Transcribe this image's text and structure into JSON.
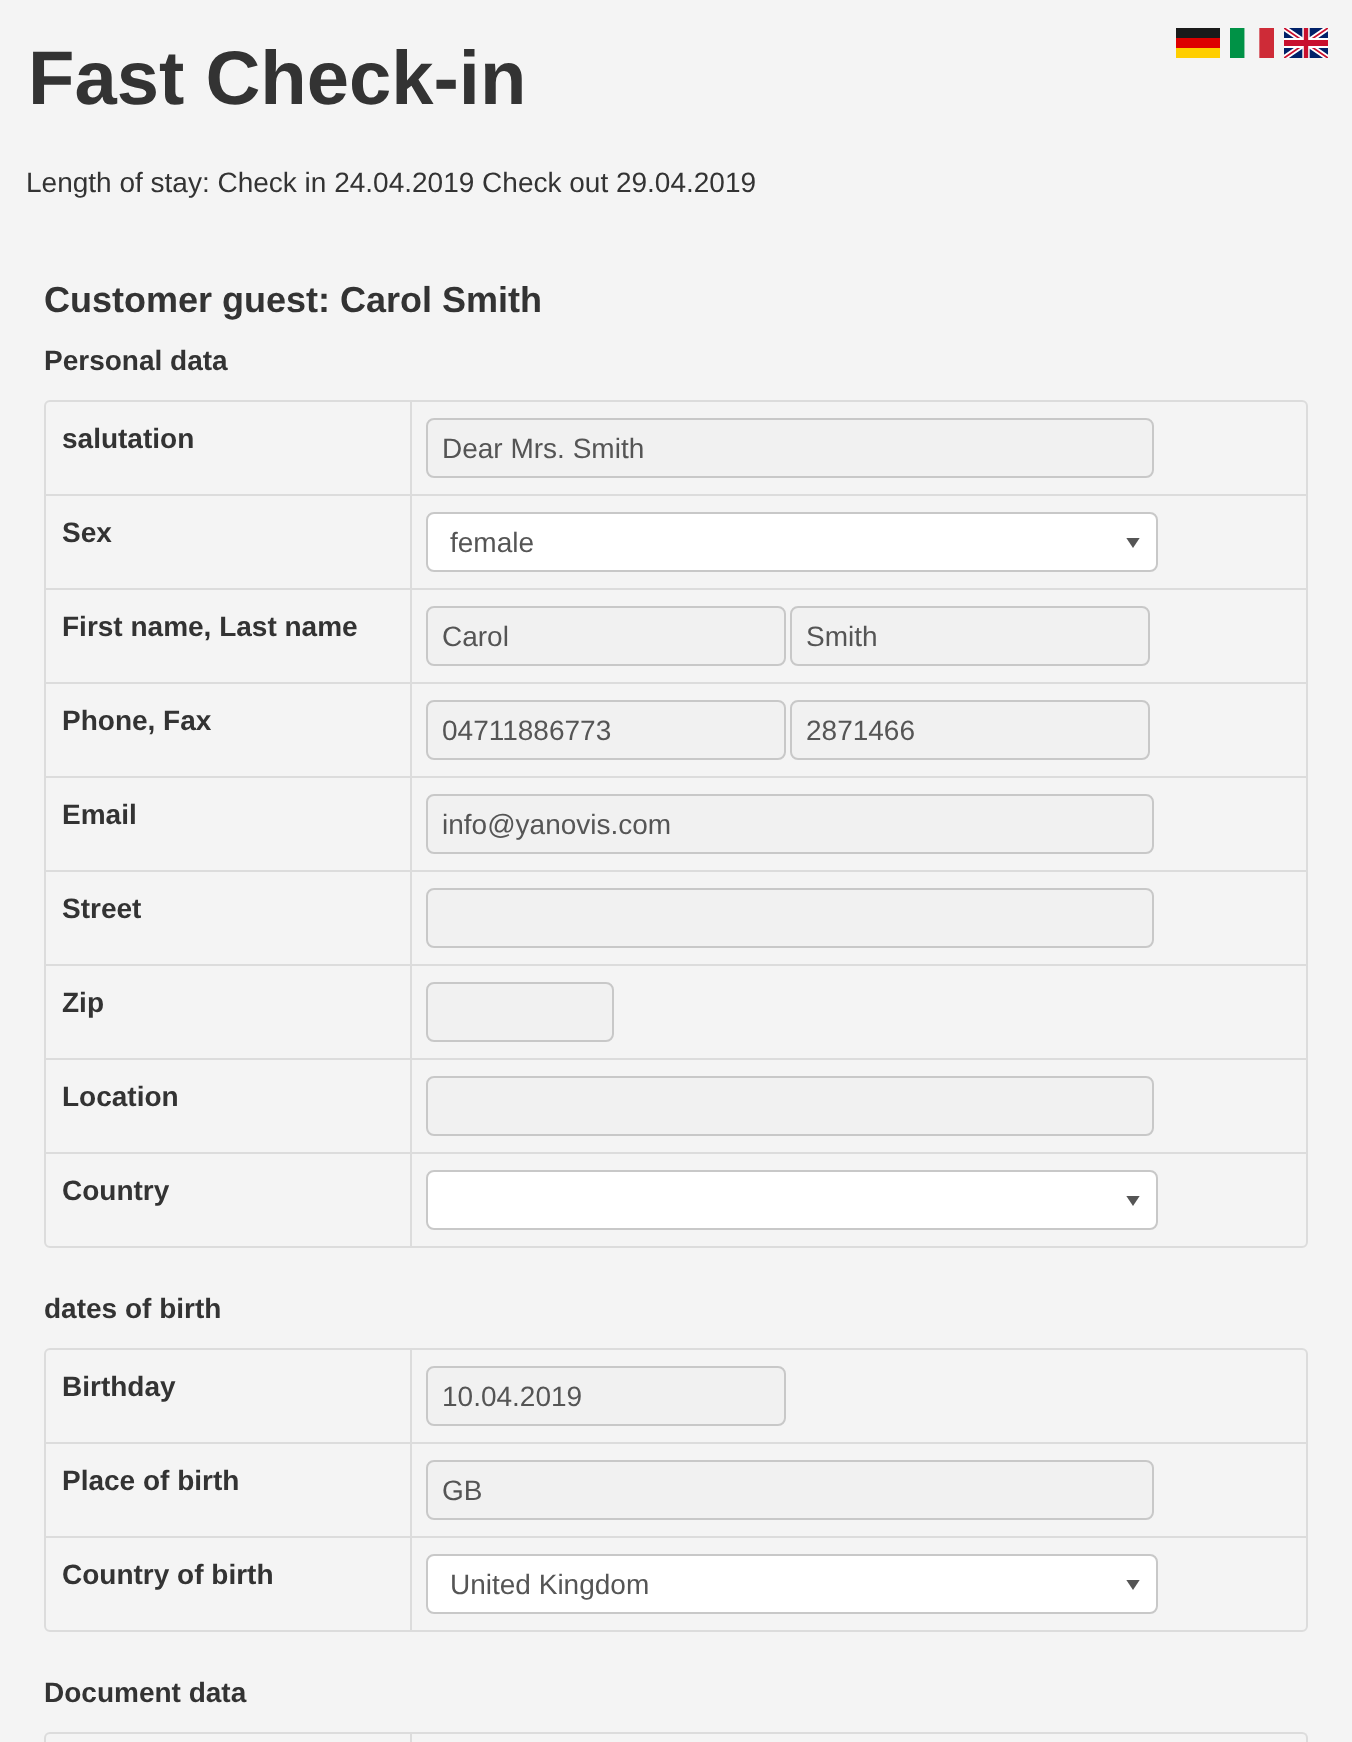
{
  "page": {
    "title": "Fast Check-in",
    "stay": "Length of stay: Check in 24.04.2019 Check out 29.04.2019"
  },
  "guest": {
    "heading": "Customer guest: Carol Smith"
  },
  "sections": [
    {
      "title": "Personal data",
      "rows": [
        {
          "label": "salutation",
          "fields": [
            {
              "kind": "text",
              "value": "Dear Mrs. Smith"
            }
          ]
        },
        {
          "label": "Sex",
          "fields": [
            {
              "kind": "select",
              "value": "female"
            }
          ]
        },
        {
          "label": "First name, Last name",
          "fields": [
            {
              "kind": "text",
              "value": "Carol"
            },
            {
              "kind": "text",
              "value": "Smith"
            }
          ]
        },
        {
          "label": "Phone, Fax",
          "fields": [
            {
              "kind": "text",
              "value": "04711886773"
            },
            {
              "kind": "text",
              "value": "2871466"
            }
          ]
        },
        {
          "label": "Email",
          "fields": [
            {
              "kind": "text",
              "value": "info@yanovis.com"
            }
          ]
        },
        {
          "label": "Street",
          "fields": [
            {
              "kind": "text"
            }
          ]
        },
        {
          "label": "Zip",
          "fields": [
            {
              "kind": "postcode"
            }
          ]
        },
        {
          "label": "Location",
          "fields": [
            {
              "kind": "text"
            }
          ]
        },
        {
          "label": "Country",
          "fields": [
            {
              "kind": "select"
            }
          ]
        }
      ]
    },
    {
      "title": "dates of birth",
      "rows": [
        {
          "label": "Birthday",
          "fields": [
            {
              "kind": "date",
              "value": "10.04.2019"
            }
          ]
        },
        {
          "label": "Place of birth",
          "fields": [
            {
              "kind": "text",
              "value": "GB"
            }
          ]
        },
        {
          "label": "Country of birth",
          "fields": [
            {
              "kind": "select",
              "value": "United Kingdom"
            }
          ]
        }
      ]
    },
    {
      "title": "Document data"
    }
  ]
}
